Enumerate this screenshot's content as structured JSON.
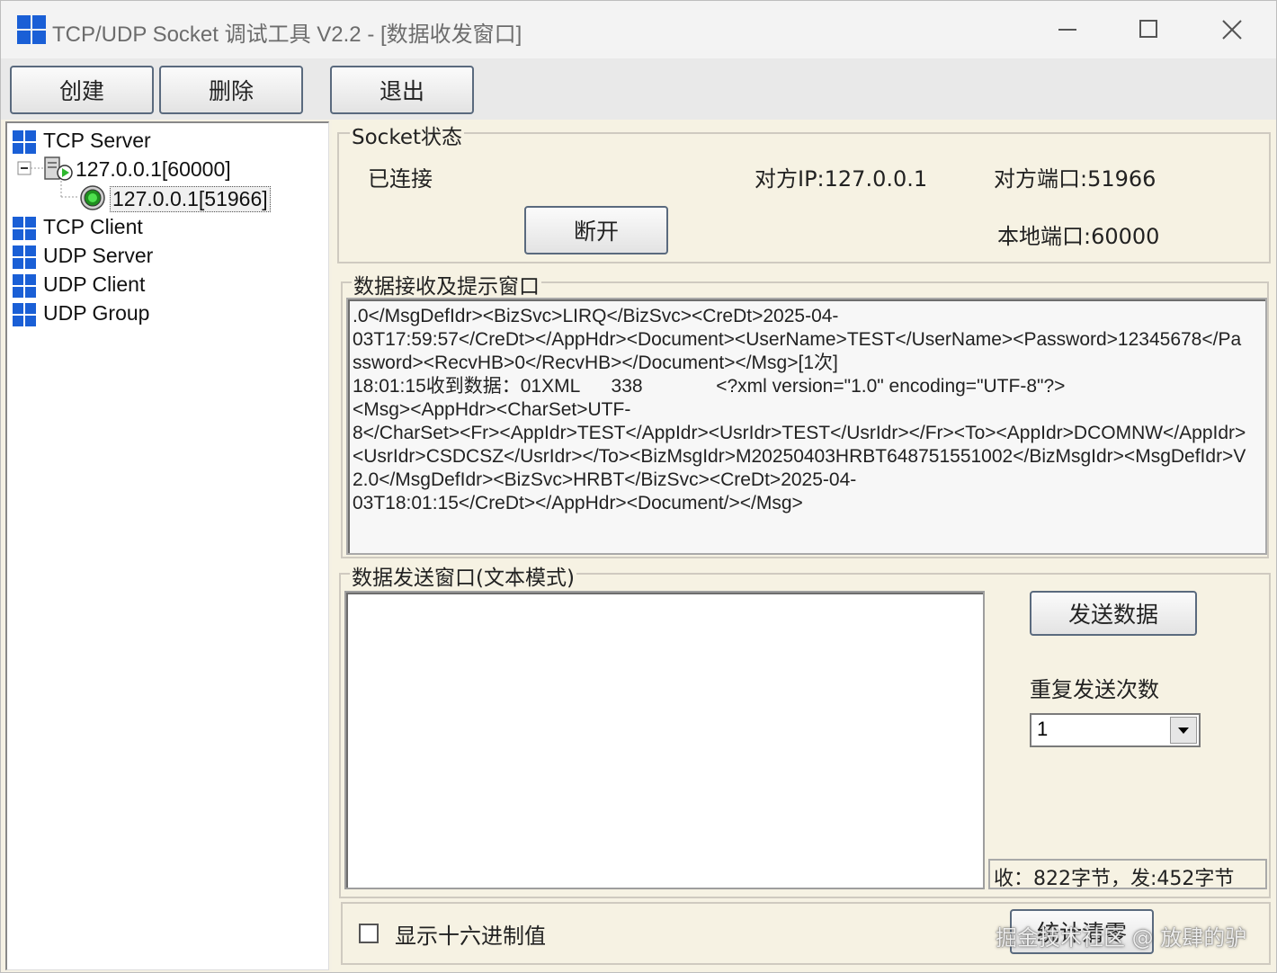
{
  "window": {
    "title": "TCP/UDP Socket 调试工具 V2.2 - [数据收发窗口]"
  },
  "toolbar": {
    "create_label": "创建",
    "delete_label": "删除",
    "exit_label": "退出"
  },
  "tree": {
    "tcp_server": "TCP Server",
    "server_node": "127.0.0.1[60000]",
    "client_node": "127.0.0.1[51966]",
    "tcp_client": "TCP Client",
    "udp_server": "UDP Server",
    "udp_client": "UDP Client",
    "udp_group": "UDP Group"
  },
  "socket_status": {
    "group_title": "Socket状态",
    "state": "已连接",
    "remote_ip": "对方IP:127.0.0.1",
    "remote_port": "对方端口:51966",
    "local_port": "本地端口:60000",
    "disconnect_label": "断开"
  },
  "receive": {
    "group_title": "数据接收及提示窗口",
    "lines": [
      ".0</MsgDefIdr><BizSvc>LIRQ</BizSvc><CreDt>2025-04-",
      "03T17:59:57</CreDt></AppHdr><Document><UserName>TEST</UserName><Password>12345678</Pa",
      "ssword><RecvHB>0</RecvHB></Document></Msg>[1次]",
      "18:01:15收到数据：01XML      338              <?xml version=\"1.0\" encoding=\"UTF-8\"?>",
      "<Msg><AppHdr><CharSet>UTF-",
      "8</CharSet><Fr><AppIdr>TEST</AppIdr><UsrIdr>TEST</UsrIdr></Fr><To><AppIdr>DCOMNW</AppIdr>",
      "<UsrIdr>CSDCSZ</UsrIdr></To><BizMsgIdr>M20250403HRBT648751551002</BizMsgIdr><MsgDefIdr>V",
      "2.0</MsgDefIdr><BizSvc>HRBT</BizSvc><CreDt>2025-04-",
      "03T18:01:15</CreDt></AppHdr><Document/></Msg>"
    ]
  },
  "send": {
    "group_title": "数据发送窗口(文本模式)",
    "text": "",
    "send_button_label": "发送数据",
    "repeat_label": "重复发送次数",
    "repeat_value": "1",
    "stats": "收：822字节，发:452字节"
  },
  "footer": {
    "hex_label": "显示十六进制值",
    "clear_label": "统计清零",
    "watermark": "掘金技术社区 @ 放肆的驴"
  },
  "colors": {
    "icon_blue": "#1a5fd6",
    "panel_bg": "#f6f2e3",
    "status_green": "#2eb82e"
  }
}
